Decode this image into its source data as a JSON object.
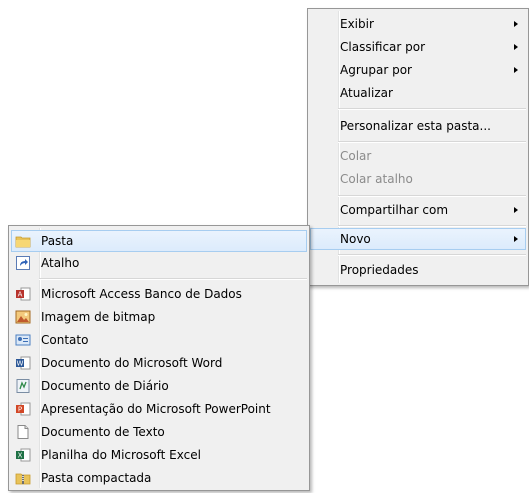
{
  "context_menu": {
    "items": [
      {
        "label": "Exibir",
        "submenu": true
      },
      {
        "label": "Classificar por",
        "submenu": true
      },
      {
        "label": "Agrupar por",
        "submenu": true
      },
      {
        "label": "Atualizar",
        "submenu": false
      },
      {
        "label": "Personalizar esta pasta...",
        "submenu": false
      },
      {
        "label": "Colar",
        "disabled": true
      },
      {
        "label": "Colar atalho",
        "disabled": true
      },
      {
        "label": "Compartilhar com",
        "submenu": true
      },
      {
        "label": "Novo",
        "submenu": true,
        "highlighted": true
      },
      {
        "label": "Propriedades",
        "submenu": false
      }
    ]
  },
  "new_submenu": {
    "items": [
      {
        "label": "Pasta",
        "icon": "folder-icon",
        "highlighted": true
      },
      {
        "label": "Atalho",
        "icon": "shortcut-icon"
      },
      {
        "label": "Microsoft Access Banco de Dados",
        "icon": "access-database-icon"
      },
      {
        "label": "Imagem de bitmap",
        "icon": "bitmap-image-icon"
      },
      {
        "label": "Contato",
        "icon": "contact-icon"
      },
      {
        "label": "Documento do Microsoft Word",
        "icon": "word-document-icon"
      },
      {
        "label": "Documento de Diário",
        "icon": "journal-document-icon"
      },
      {
        "label": "Apresentação do Microsoft PowerPoint",
        "icon": "powerpoint-presentation-icon"
      },
      {
        "label": "Documento de Texto",
        "icon": "text-document-icon"
      },
      {
        "label": "Planilha do Microsoft Excel",
        "icon": "excel-spreadsheet-icon"
      },
      {
        "label": "Pasta compactada",
        "icon": "compressed-folder-icon"
      }
    ]
  },
  "colors": {
    "menu_background": "#f0f0f0",
    "highlight_border": "#a7cdf0",
    "highlight_fill": "#dcebfc",
    "disabled_text": "#8b8b8b"
  }
}
